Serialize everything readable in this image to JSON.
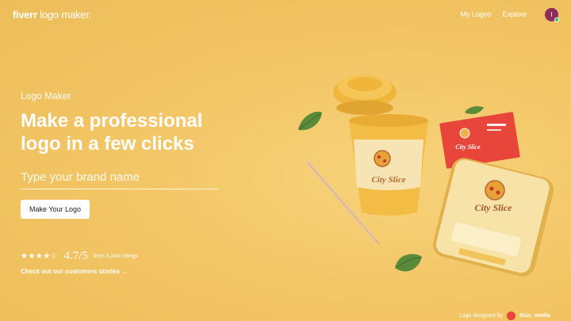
{
  "header": {
    "brand_fiverr": "fiverr",
    "brand_rest": " logo maker.",
    "nav": [
      "My Logos",
      "Explore"
    ],
    "avatar_initial": "I"
  },
  "hero": {
    "eyebrow": "Logo Maker",
    "headline": "Make a professional logo in a few clicks",
    "input_placeholder": "Type your brand name",
    "input_value": "",
    "cta_label": "Make Your Logo",
    "stars": "★★★★☆",
    "rating_score": "4.7/5",
    "rating_count": "from 4,244 ratings",
    "stories_link": "Check out our customers stories →"
  },
  "mockup": {
    "cup_brand": "City Slice",
    "card_brand": "City Slice",
    "phone_brand": "City Slice"
  },
  "credit": {
    "label": "Logo designed by",
    "name": "titus_media"
  },
  "colors": {
    "background": "#f3c768",
    "cup": "#f0b63c",
    "card": "#e8463a",
    "avatar": "#8e2c5c"
  }
}
